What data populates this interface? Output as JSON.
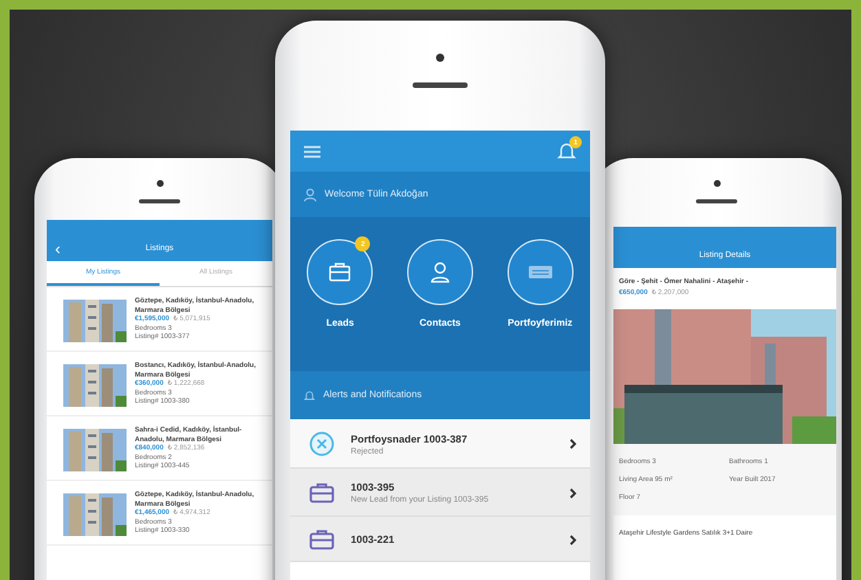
{
  "left_phone": {
    "title": "Listings",
    "back": "‹",
    "tabs": [
      {
        "label": "My Listings",
        "selected": true
      },
      {
        "label": "All Listings",
        "selected": false
      }
    ],
    "listings": [
      {
        "location": "Göztepe, Kadıköy, İstanbul-Anadolu, Marmara Bölgesi",
        "price": "€1,595,000",
        "alt_price": "₺ 5,071,915",
        "bedrooms": "Bedrooms 3",
        "listing_no": "Listing# 1003-377"
      },
      {
        "location": "Bostancı, Kadıköy, İstanbul-Anadolu, Marmara Bölgesi",
        "price": "€360,000",
        "alt_price": "₺ 1,222,668",
        "bedrooms": "Bedrooms 3",
        "listing_no": "Listing# 1003-380"
      },
      {
        "location": "Sahra-i Cedid, Kadıköy, İstanbul-Anadolu, Marmara Bölgesi",
        "price": "€840,000",
        "alt_price": "₺ 2,852,136",
        "bedrooms": "Bedrooms 2",
        "listing_no": "Listing# 1003-445"
      },
      {
        "location": "Göztepe, Kadıköy, İstanbul-Anadolu, Marmara Bölgesi",
        "price": "€1,465,000",
        "alt_price": "₺ 4,974,312",
        "bedrooms": "Bedrooms 3",
        "listing_no": "Listing# 1003-330"
      }
    ]
  },
  "center_phone": {
    "bell_badge": "1",
    "welcome": "Welcome Tülin Akdoğan",
    "shortcuts": [
      {
        "label": "Leads",
        "kind": "briefcase",
        "badge": "2"
      },
      {
        "label": "Contacts",
        "kind": "person"
      },
      {
        "label": "Portfoyferimiz",
        "kind": "card"
      }
    ],
    "alerts_title": "Alerts and Notifications",
    "notifications": [
      {
        "kind": "rejected",
        "title": "Portfoysnader 1003-387",
        "detail": "Rejected"
      },
      {
        "kind": "lead",
        "title": "1003-395",
        "detail": "New Lead from your Listing 1003-395"
      },
      {
        "kind": "lead",
        "title": "1003-221"
      }
    ]
  },
  "right_phone": {
    "title": "Listing Details",
    "heading": "Göre - Şehit - Ömer Nahalini - Ataşehir -",
    "price": "€650,000",
    "alt_price": "₺ 2,207,000",
    "facts": [
      "Bedrooms 3",
      "Bathrooms 1",
      "Living Area 95 m²",
      "Year Built 2017",
      "Floor 7"
    ],
    "description": "Ataşehir Lifestyle Gardens Satılık 3+1 Daire"
  }
}
